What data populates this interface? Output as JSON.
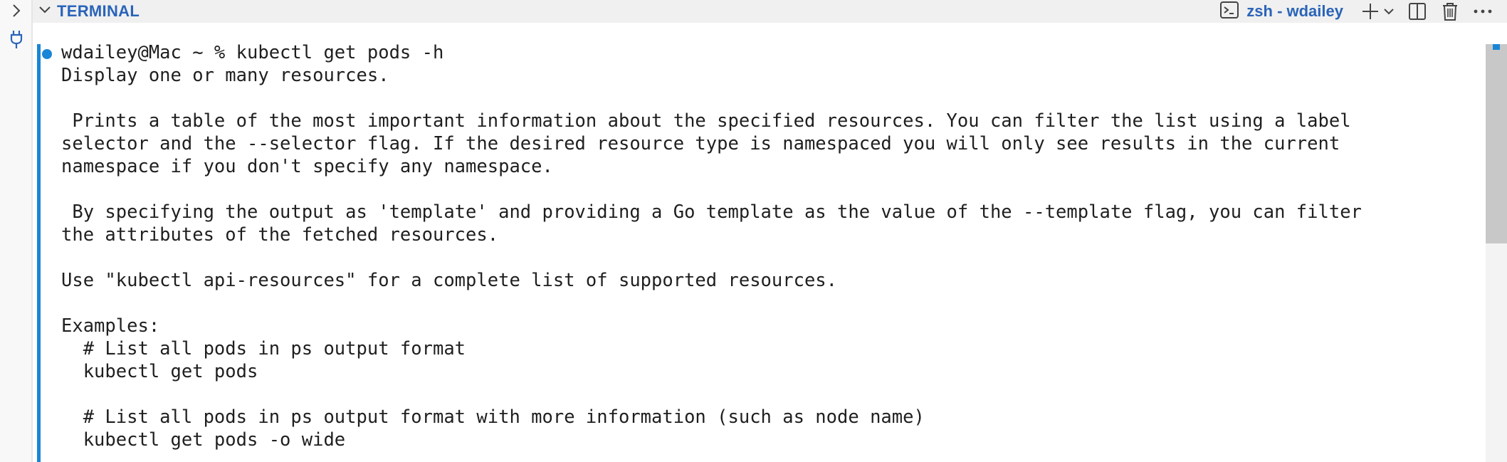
{
  "panel": {
    "title": "TERMINAL",
    "terminal_name": "zsh - wdailey"
  },
  "colors": {
    "accent": "#2a64b8",
    "prompt_blue": "#1a85d6",
    "text": "#1f1f1f"
  },
  "icons": {
    "expand": "chevron-right-icon",
    "collapse": "chevron-down-icon",
    "ports": "plug-icon",
    "terminal": "terminal-icon",
    "new_terminal": "plus-icon",
    "dropdown": "chevron-down-icon",
    "split": "split-icon",
    "kill": "trash-icon",
    "more": "ellipsis-icon"
  },
  "terminal": {
    "lines": [
      "wdailey@Mac ~ % kubectl get pods -h",
      "Display one or many resources.",
      "",
      " Prints a table of the most important information about the specified resources. You can filter the list using a label",
      "selector and the --selector flag. If the desired resource type is namespaced you will only see results in the current",
      "namespace if you don't specify any namespace.",
      "",
      " By specifying the output as 'template' and providing a Go template as the value of the --template flag, you can filter",
      "the attributes of the fetched resources.",
      "",
      "Use \"kubectl api-resources\" for a complete list of supported resources.",
      "",
      "Examples:",
      "  # List all pods in ps output format",
      "  kubectl get pods",
      "",
      "  # List all pods in ps output format with more information (such as node name)",
      "  kubectl get pods -o wide"
    ]
  }
}
